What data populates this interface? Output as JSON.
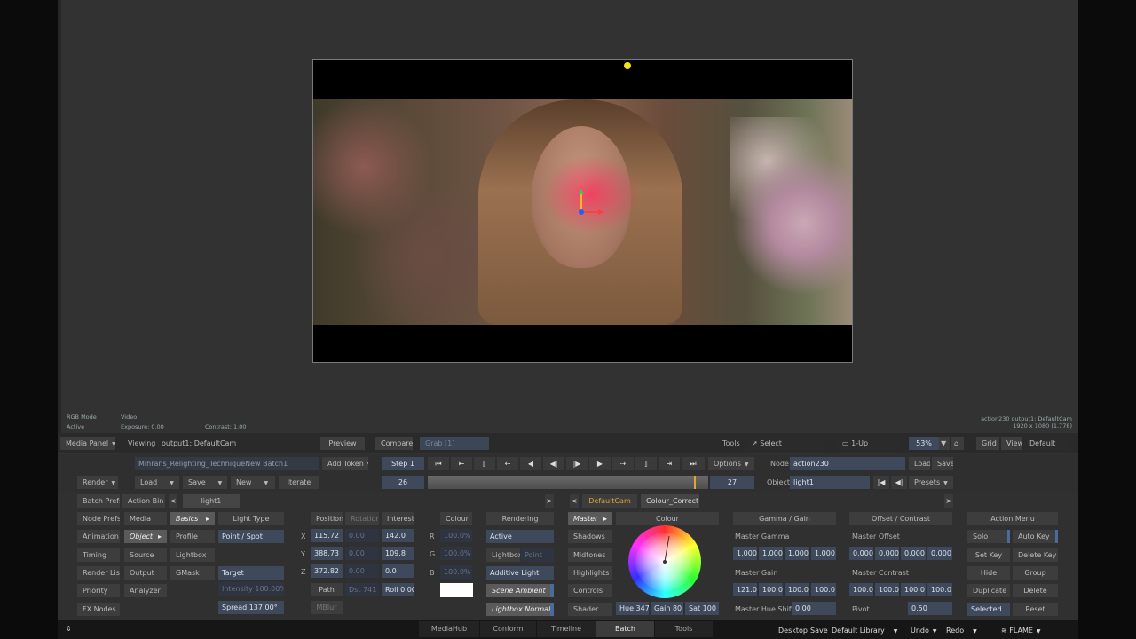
{
  "viewer_info": {
    "mode": "RGB Mode",
    "state": "Active",
    "source": "Video",
    "exposure": "Exposure: 0.00",
    "contrast": "Contrast: 1.00",
    "node_out": "action230 output1: DefaultCam",
    "resolution": "1920 x 1080 (1.778)"
  },
  "toolbar1": {
    "media_panel": "Media Panel",
    "viewing_label": "Viewing",
    "viewing_value": "output1: DefaultCam",
    "preview": "Preview",
    "compare": "Compare",
    "grab": "Grab [1]",
    "tools_label": "Tools",
    "select": "Select",
    "layout": "1-Up",
    "zoom": "53%",
    "grid": "Grid",
    "view": "View",
    "default": "Default"
  },
  "toolbar2": {
    "batch_name": "Mihrans_Relighting_TechniqueNew Batch1",
    "add_token": "Add Token",
    "step": "Step 1",
    "frame_left": "26",
    "frame_right": "27",
    "options": "Options",
    "node_label": "Node",
    "node_value": "action230",
    "load": "Load",
    "save": "Save",
    "object_label": "Object",
    "object_value": "light1",
    "presets": "Presets",
    "render": "Render",
    "load2": "Load",
    "save2": "Save",
    "new": "New",
    "iterate": "Iterate"
  },
  "left_menu": {
    "batch_prefs": "Batch Prefs",
    "action_bin": "Action Bin",
    "tab_light": "light1",
    "node_prefs": "Node Prefs",
    "animation": "Animation",
    "timing": "Timing",
    "render_list": "Render List",
    "priority": "Priority",
    "fx_nodes": "FX Nodes",
    "media": "Media",
    "object": "Object",
    "source": "Source",
    "output": "Output",
    "analyzer": "Analyzer",
    "basics": "Basics",
    "profile": "Profile",
    "lightbox": "Lightbox",
    "gmask": "GMask"
  },
  "light": {
    "light_type_label": "Light Type",
    "light_type": "Point / Spot",
    "target": "Target",
    "intensity": "Intensity 100.00%",
    "spread": "Spread 137.00°",
    "position": "Position",
    "rotation": "Rotation",
    "interest": "Interest",
    "x": "X",
    "y": "Y",
    "z": "Z",
    "pos_x": "115.72",
    "pos_y": "388.73",
    "pos_z": "372.82",
    "rot_x": "0.00",
    "rot_y": "0.00",
    "rot_z": "0.00",
    "int_x": "142.0",
    "int_y": "109.8",
    "int_z": "0.0",
    "path": "Path",
    "dist": "Dst 741",
    "roll": "Roll 0.00",
    "mblur": "MBlur",
    "colour": "Colour",
    "r": "R",
    "g": "G",
    "b": "B",
    "r_val": "100.0%",
    "g_val": "100.0%",
    "b_val": "100.0%",
    "rendering": "Rendering",
    "active": "Active",
    "lightbox": "Lightbox",
    "point": "Point",
    "additive": "Additive Light",
    "scene_ambient": "Scene Ambient",
    "lightbox_normals": "Lightbox Normals"
  },
  "cc": {
    "tab_cam": "DefaultCam",
    "tab_cc": "Colour_Correct1",
    "master": "Master",
    "shadows": "Shadows",
    "midtones": "Midtones",
    "highlights": "Highlights",
    "controls": "Controls",
    "shader": "Shader",
    "colour": "Colour",
    "hue": "Hue 347",
    "gain": "Gain 80",
    "sat": "Sat 100",
    "gamma_gain": "Gamma / Gain",
    "master_gamma": "Master Gamma",
    "gamma_vals": [
      "1.000",
      "1.000",
      "1.000",
      "1.000"
    ],
    "master_gain": "Master Gain",
    "gain_vals": [
      "121.0",
      "100.0",
      "100.0",
      "100.0"
    ],
    "master_hue_shift": "Master Hue Shift",
    "hue_shift_val": "0.00",
    "offset_contrast": "Offset / Contrast",
    "master_offset": "Master Offset",
    "offset_vals": [
      "0.000",
      "0.000",
      "0.000",
      "0.000"
    ],
    "master_contrast": "Master Contrast",
    "contrast_vals": [
      "100.0",
      "100.0",
      "100.0",
      "100.0"
    ],
    "pivot": "Pivot",
    "pivot_val": "0.50"
  },
  "action_menu": {
    "title": "Action Menu",
    "solo": "Solo",
    "auto_key": "Auto Key",
    "set_key": "Set Key",
    "delete_key": "Delete Key",
    "hide": "Hide",
    "group": "Group",
    "duplicate": "Duplicate",
    "delete": "Delete",
    "selected": "Selected",
    "reset": "Reset"
  },
  "tabs": [
    "MediaHub",
    "Conform",
    "Timeline",
    "Batch",
    "Tools"
  ],
  "status": {
    "desktop": "Desktop",
    "save": "Save",
    "library": "Default Library",
    "undo": "Undo",
    "redo": "Redo",
    "brand": "FLAME"
  },
  "colors": {
    "accent": "#e3a437",
    "field": "#3e4a5c",
    "bg": "#323232"
  }
}
